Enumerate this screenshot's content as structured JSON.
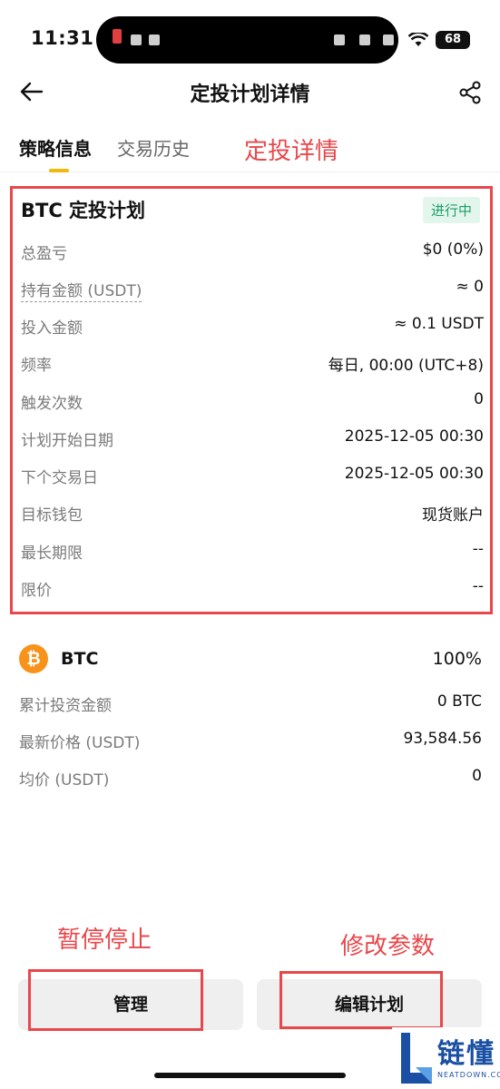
{
  "status_bar": {
    "time": "11:31",
    "battery": "68"
  },
  "nav": {
    "title": "定投计划详情"
  },
  "tabs": [
    {
      "label": "策略信息",
      "active": true
    },
    {
      "label": "交易历史",
      "active": false
    }
  ],
  "annotations": {
    "detail": "定投详情",
    "pause": "暂停停止",
    "edit": "修改参数"
  },
  "plan": {
    "title": "BTC 定投计划",
    "status": "进行中",
    "rows": [
      {
        "label": "总盈亏",
        "value": "$0 (0%)"
      },
      {
        "label": "持有金额 (USDT)",
        "value": "≈ 0"
      },
      {
        "label": "投入金额",
        "value": "≈ 0.1 USDT"
      },
      {
        "label": "频率",
        "value": "每日, 00:00 (UTC+8)"
      },
      {
        "label": "触发次数",
        "value": "0"
      },
      {
        "label": "计划开始日期",
        "value": "2025-12-05 00:30"
      },
      {
        "label": "下个交易日",
        "value": "2025-12-05 00:30"
      },
      {
        "label": "目标钱包",
        "value": "现货账户"
      },
      {
        "label": "最长期限",
        "value": "--"
      },
      {
        "label": "限价",
        "value": "--"
      }
    ]
  },
  "asset": {
    "icon_glyph": "₿",
    "name": "BTC",
    "percent": "100%",
    "rows": [
      {
        "label": "累计投资金额",
        "value": "0 BTC"
      },
      {
        "label": "最新价格 (USDT)",
        "value": "93,584.56"
      },
      {
        "label": "均价 (USDT)",
        "value": "0"
      }
    ]
  },
  "buttons": {
    "manage": "管理",
    "edit": "编辑计划"
  },
  "watermark": {
    "text": "链懂",
    "sub": "NEATDOWN.COM"
  },
  "colors": {
    "accent": "#f0b90b",
    "annotation": "#e8474b",
    "status_green": "#1d9e66",
    "btc": "#f7931a"
  }
}
